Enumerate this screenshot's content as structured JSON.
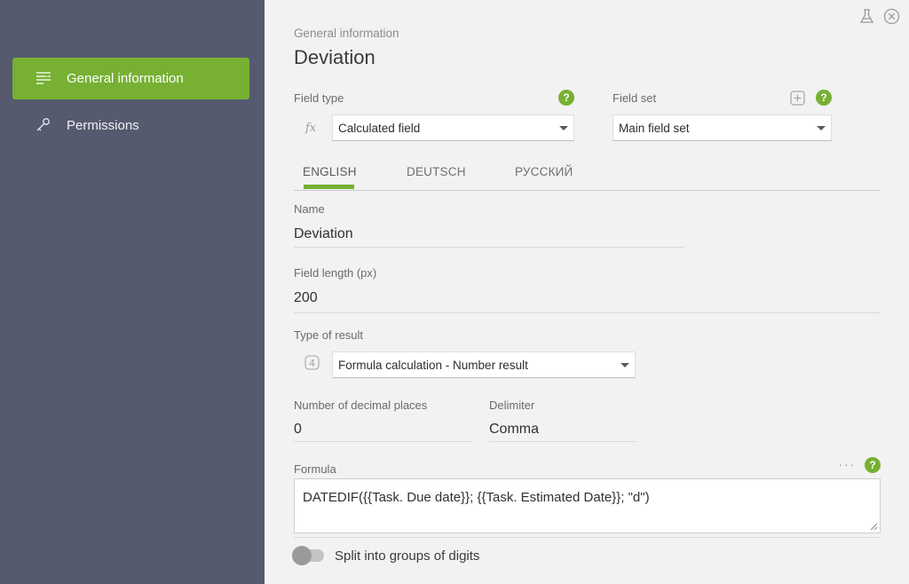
{
  "sidebar": {
    "items": [
      {
        "label": "General information",
        "icon": "list-lines-icon",
        "active": true
      },
      {
        "label": "Permissions",
        "icon": "key-icon",
        "active": false
      }
    ]
  },
  "header": {
    "breadcrumb": "General information",
    "title": "Deviation"
  },
  "field_type": {
    "label": "Field type",
    "prefix_icon": "fx-icon",
    "value": "Calculated field"
  },
  "field_set": {
    "label": "Field set",
    "value": "Main field set"
  },
  "tabs": [
    {
      "label": "ENGLISH",
      "active": true
    },
    {
      "label": "DEUTSCH",
      "active": false
    },
    {
      "label": "РУССКИЙ",
      "active": false
    }
  ],
  "name": {
    "label": "Name",
    "value": "Deviation"
  },
  "field_length": {
    "label": "Field length (px)",
    "value": "200"
  },
  "result_type": {
    "label": "Type of result",
    "prefix_icon": "number-4-icon",
    "value": "Formula calculation - Number result"
  },
  "decimal_places": {
    "label": "Number of decimal places",
    "value": "0"
  },
  "delimiter": {
    "label": "Delimiter",
    "value": "Comma"
  },
  "formula": {
    "label": "Formula",
    "value": "DATEDIF({{Task. Due date}}; {{Task. Estimated Date}}; \"d\")"
  },
  "split_digits": {
    "label": "Split into groups of digits",
    "enabled": false
  },
  "help_symbol": "?",
  "colors": {
    "sidebar_bg": "#555a6e",
    "accent_green": "#77b033",
    "main_bg": "#f2f2f2"
  }
}
